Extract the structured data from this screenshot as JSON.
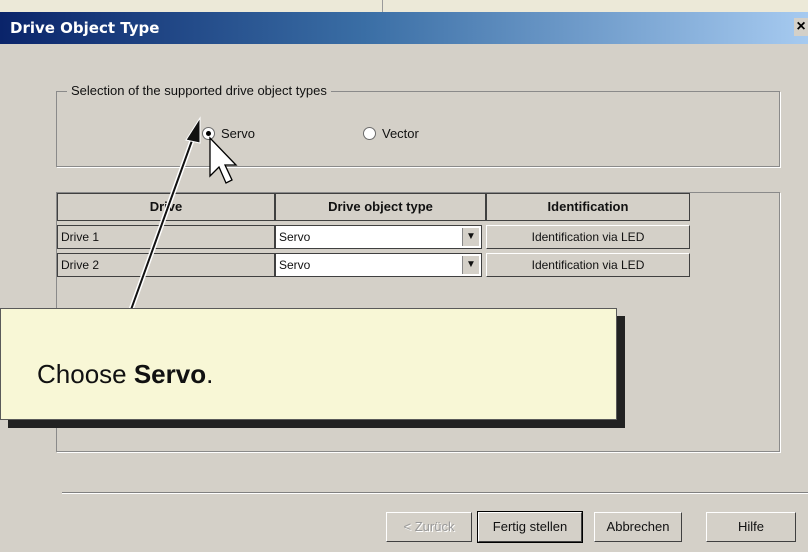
{
  "dialog": {
    "title": "Drive Object Type",
    "close_glyph": "×"
  },
  "group": {
    "legend": "Selection of the supported drive object types",
    "options": [
      {
        "label": "Servo",
        "selected": true
      },
      {
        "label": "Vector",
        "selected": false
      }
    ]
  },
  "table": {
    "headers": [
      "Drive",
      "Drive object type",
      "Identification"
    ],
    "rows": [
      {
        "drive": "Drive 1",
        "type": "Servo",
        "button": "Identification via LED"
      },
      {
        "drive": "Drive 2",
        "type": "Servo",
        "button": "Identification via LED"
      }
    ]
  },
  "callout": {
    "prefix": "Choose ",
    "emphasis": "Servo",
    "suffix": "."
  },
  "footer": {
    "back": "< Zurück",
    "finish": "Fertig stellen",
    "cancel": "Abbrechen",
    "help": "Hilfe"
  },
  "icons": {
    "close": "close-icon",
    "dropdown": "chevron-down-icon",
    "cursor": "mouse-pointer-icon"
  }
}
